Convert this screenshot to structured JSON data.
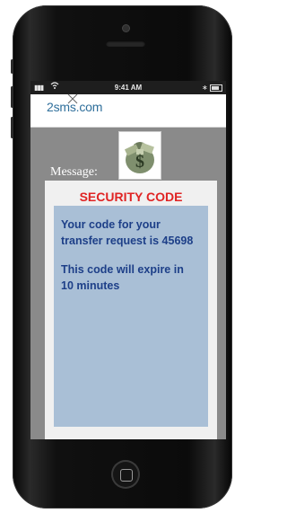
{
  "status_bar": {
    "signal": "▮▮▮",
    "time": "9:41 AM",
    "bluetooth": "∗"
  },
  "app": {
    "logo_text": "2sms.com"
  },
  "message": {
    "label": "Message:",
    "icon": "money-bag-icon",
    "title": "SECURITY CODE",
    "line1": "Your code for your transfer request is 45698",
    "line2": "This code will expire in 10 minutes"
  },
  "colors": {
    "title_red": "#e02424",
    "body_blue": "#1d3f88",
    "bubble_bg": "#a9bfd6"
  }
}
